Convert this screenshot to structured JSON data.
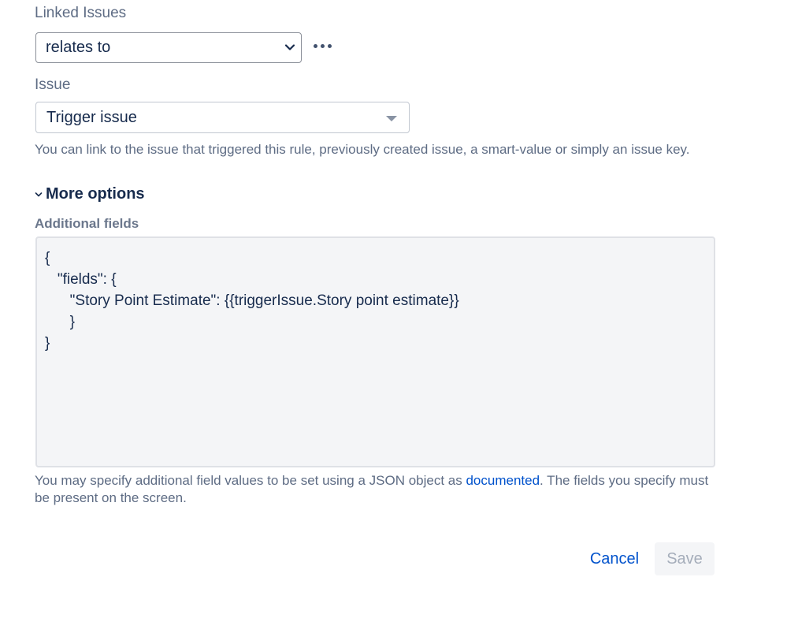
{
  "linked_issues": {
    "label": "Linked Issues",
    "selected": "relates to",
    "options": [
      "relates to"
    ]
  },
  "issue": {
    "label": "Issue",
    "selected": "Trigger issue",
    "help": "You can link to the issue that triggered this rule, previously created issue, a smart-value or simply an issue key."
  },
  "more_options": {
    "label": "More options"
  },
  "additional_fields": {
    "label": "Additional fields",
    "value": "{\n   \"fields\": {\n      \"Story Point Estimate\": {{triggerIssue.Story point estimate}}\n      }\n}",
    "help_before": "You may specify additional field values to be set using a JSON object as ",
    "help_link": "documented",
    "help_after": ". The fields you specify must be present on the screen."
  },
  "actions": {
    "cancel_label": "Cancel",
    "save_label": "Save"
  },
  "icons": {
    "select_chevron": "chevron-down-icon",
    "more": "more-horizontal-icon",
    "dropdown": "caret-down-icon",
    "expand": "chevron-down-icon"
  },
  "colors": {
    "link": "#0052cc",
    "text": "#172b4d",
    "muted": "#5e6c84",
    "textarea_bg": "#f4f5f7"
  }
}
